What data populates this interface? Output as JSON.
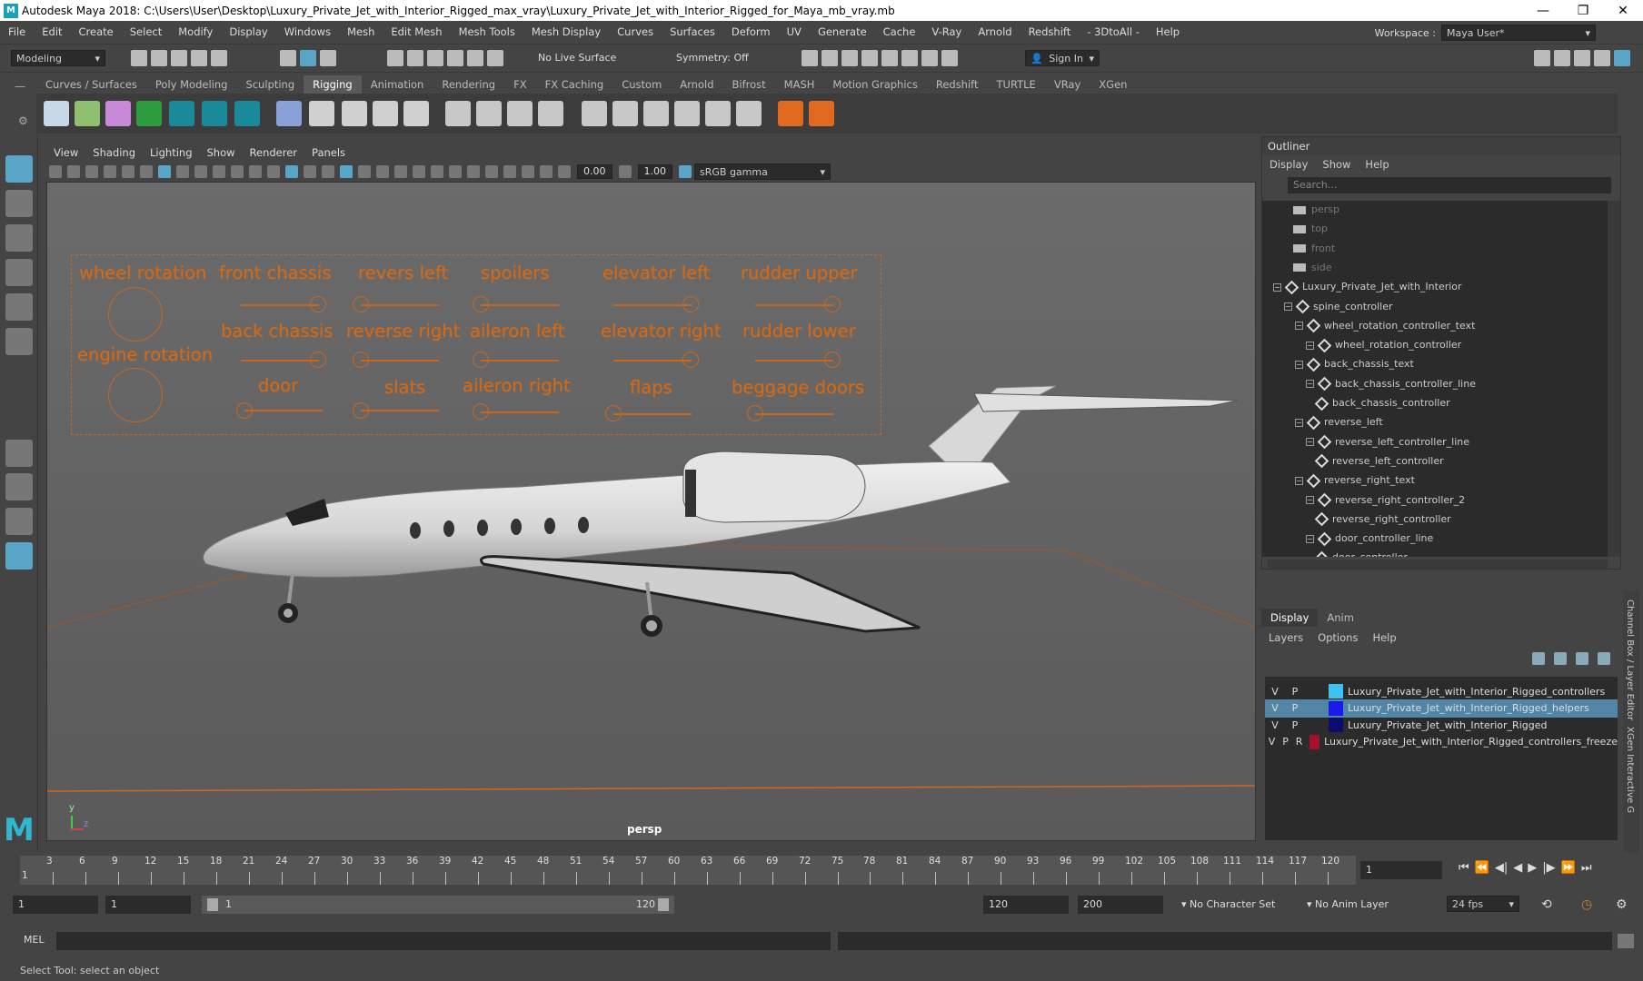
{
  "window": {
    "title": "Autodesk Maya 2018: C:\\Users\\User\\Desktop\\Luxury_Private_Jet_with_Interior_Rigged_max_vray\\Luxury_Private_Jet_with_Interior_Rigged_for_Maya_mb_vray.mb",
    "minimize": "—",
    "maximize": "❐",
    "close": "✕"
  },
  "menubar": [
    "File",
    "Edit",
    "Create",
    "Select",
    "Modify",
    "Display",
    "Windows",
    "Mesh",
    "Edit Mesh",
    "Mesh Tools",
    "Mesh Display",
    "Curves",
    "Surfaces",
    "Deform",
    "UV",
    "Generate",
    "Cache",
    "V-Ray",
    "Arnold",
    "Redshift",
    "- 3DtoAll -",
    "Help"
  ],
  "workspace": {
    "label": "Workspace :",
    "value": "Maya User*"
  },
  "statusline": {
    "mode": "Modeling",
    "live_surface": "No Live Surface",
    "symmetry": "Symmetry: Off",
    "sign_in": "Sign In"
  },
  "shelf_tabs": [
    "Curves / Surfaces",
    "Poly Modeling",
    "Sculpting",
    "Rigging",
    "Animation",
    "Rendering",
    "FX",
    "FX Caching",
    "Custom",
    "Arnold",
    "Bifrost",
    "MASH",
    "Motion Graphics",
    "Redshift",
    "TURTLE",
    "VRay",
    "XGen"
  ],
  "shelf_active": "Rigging",
  "viewport": {
    "menu": [
      "View",
      "Shading",
      "Lighting",
      "Show",
      "Renderer",
      "Panels"
    ],
    "exposure": "0.00",
    "gamma": "1.00",
    "color_space": "sRGB gamma",
    "camera_label": "persp",
    "axis_y": "y",
    "axis_z": "z"
  },
  "controls": {
    "wheel_rotation": "wheel rotation",
    "engine_rotation": "engine rotation",
    "front_chassis": "front chassis",
    "back_chassis": "back chassis",
    "door": "door",
    "revers_left": "revers left",
    "reverse_right": "reverse right",
    "slats": "slats",
    "spoilers": "spoilers",
    "aileron_left": "aileron left",
    "aileron_right": "aileron right",
    "elevator_left": "elevator left",
    "elevator_right": "elevator right",
    "flaps": "flaps",
    "rudder_upper": "rudder upper",
    "rudder_lower": "rudder lower",
    "beggage_doors": "beggage doors"
  },
  "outliner": {
    "title": "Outliner",
    "menu": [
      "Display",
      "Show",
      "Help"
    ],
    "search_placeholder": "Search...",
    "items": [
      {
        "label": "persp",
        "type": "camera",
        "depth": 0,
        "dim": true
      },
      {
        "label": "top",
        "type": "camera",
        "depth": 0,
        "dim": true
      },
      {
        "label": "front",
        "type": "camera",
        "depth": 0,
        "dim": true
      },
      {
        "label": "side",
        "type": "camera",
        "depth": 0,
        "dim": true
      },
      {
        "label": "Luxury_Private_Jet_with_Interior",
        "type": "transform",
        "depth": 0
      },
      {
        "label": "spine_controller",
        "type": "transform",
        "depth": 1
      },
      {
        "label": "wheel_rotation_controller_text",
        "type": "transform",
        "depth": 2
      },
      {
        "label": "wheel_rotation_controller",
        "type": "transform",
        "depth": 3
      },
      {
        "label": "back_chassis_text",
        "type": "transform",
        "depth": 2
      },
      {
        "label": "back_chassis_controller_line",
        "type": "transform",
        "depth": 3
      },
      {
        "label": "back_chassis_controller",
        "type": "transform",
        "depth": 4
      },
      {
        "label": "reverse_left",
        "type": "transform",
        "depth": 2
      },
      {
        "label": "reverse_left_controller_line",
        "type": "transform",
        "depth": 3
      },
      {
        "label": "reverse_left_controller",
        "type": "transform",
        "depth": 4
      },
      {
        "label": "reverse_right_text",
        "type": "transform",
        "depth": 2
      },
      {
        "label": "reverse_right_controller_2",
        "type": "transform",
        "depth": 3
      },
      {
        "label": "reverse_right_controller",
        "type": "transform",
        "depth": 4
      },
      {
        "label": "door_controller_line",
        "type": "transform",
        "depth": 3
      },
      {
        "label": "door_controller",
        "type": "transform",
        "depth": 4
      }
    ]
  },
  "channel_box": {
    "tabs": [
      "Display",
      "Anim"
    ],
    "menu": [
      "Layers",
      "Options",
      "Help"
    ],
    "layers": [
      {
        "v": "V",
        "p": "P",
        "r": "",
        "name": "Luxury_Private_Jet_with_Interior_Rigged_controllers",
        "color": "#3fc2f0",
        "selected": false
      },
      {
        "v": "V",
        "p": "P",
        "r": "",
        "name": "Luxury_Private_Jet_with_Interior_Rigged_helpers",
        "color": "#1a1ae8",
        "selected": true
      },
      {
        "v": "V",
        "p": "P",
        "r": "",
        "name": "Luxury_Private_Jet_with_Interior_Rigged",
        "color": "#0c0c6a",
        "selected": false
      },
      {
        "v": "V",
        "p": "P",
        "r": "R",
        "name": "Luxury_Private_Jet_with_Interior_Rigged_controllers_freeze",
        "color": "#a5102a",
        "selected": false
      }
    ],
    "side_tab_1": "Channel Box / Layer Editor",
    "side_tab_2": "XGen Interactive G"
  },
  "timeline": {
    "ticks": [
      "3",
      "6",
      "9",
      "12",
      "15",
      "18",
      "21",
      "24",
      "27",
      "30",
      "33",
      "36",
      "39",
      "42",
      "45",
      "48",
      "51",
      "54",
      "57",
      "60",
      "63",
      "66",
      "69",
      "72",
      "75",
      "78",
      "81",
      "84",
      "87",
      "90",
      "93",
      "96",
      "99",
      "102",
      "105",
      "108",
      "111",
      "114",
      "117",
      "120"
    ],
    "current_frame": "1",
    "frame_field": "1"
  },
  "range": {
    "start": "1",
    "anim_start": "1",
    "range_start": "1",
    "range_end": "120",
    "anim_end_a": "120",
    "anim_end_b": "200",
    "character_set": "No Character Set",
    "anim_layer": "No Anim Layer",
    "fps": "24 fps"
  },
  "command_line": {
    "label": "MEL"
  },
  "help_line": "Select Tool: select an object"
}
